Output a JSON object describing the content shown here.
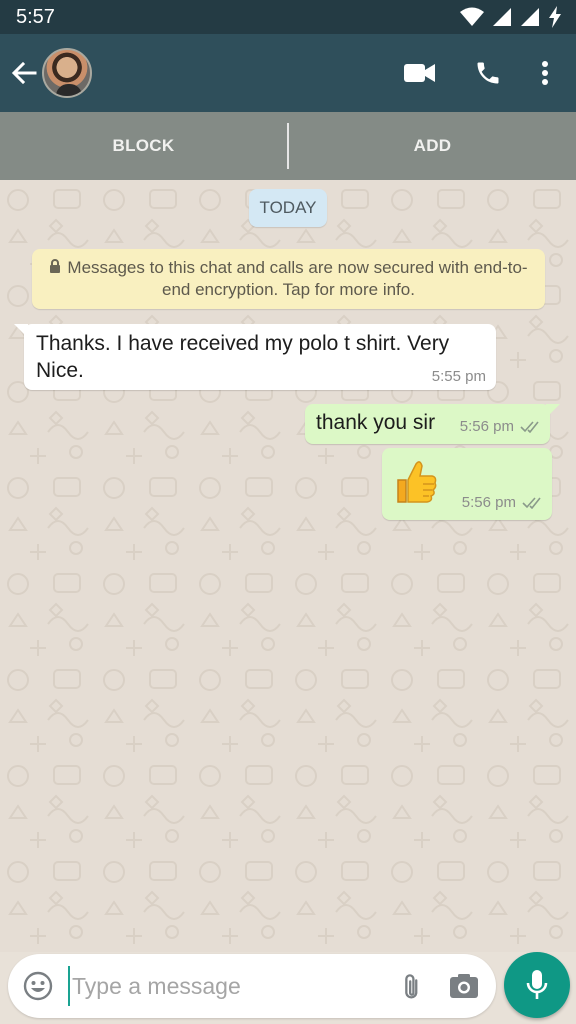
{
  "status_bar": {
    "time": "5:57",
    "icons": [
      "wifi-icon",
      "signal-icon",
      "signal-icon",
      "battery-charging-icon"
    ]
  },
  "app_bar": {
    "back_icon": "arrow-back-icon",
    "avatar": "contact-avatar",
    "actions": [
      "video-call-icon",
      "voice-call-icon",
      "more-vert-icon"
    ]
  },
  "block_bar": {
    "block_label": "BLOCK",
    "add_label": "ADD"
  },
  "chat": {
    "date_label": "TODAY",
    "encryption_notice": "Messages to this chat and calls are now secured with end-to-end encryption. Tap for more info.",
    "messages": [
      {
        "direction": "in",
        "text": "Thanks. I have received my polo t shirt. Very Nice.",
        "time": "5:55 pm"
      },
      {
        "direction": "out",
        "text": "thank you sir",
        "time": "5:56 pm",
        "status": "read"
      },
      {
        "direction": "out",
        "text": "👍",
        "time": "5:56 pm",
        "status": "read"
      }
    ]
  },
  "input": {
    "placeholder": "Type a message",
    "value": ""
  },
  "colors": {
    "header": "#2f4f5b",
    "status_bar": "#243b44",
    "outgoing_bubble": "#dcf8c6",
    "mic_button": "#0f9885",
    "read_ticks": "#8a9a8a"
  }
}
